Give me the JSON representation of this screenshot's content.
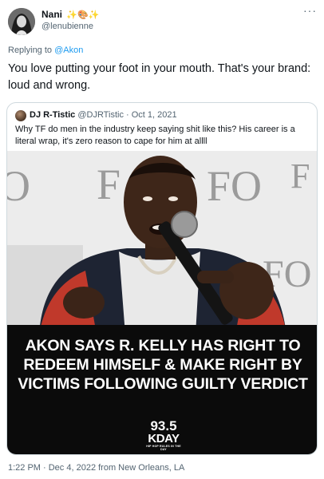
{
  "author": {
    "display_name": "Nani",
    "badge": "✨🎨✨",
    "handle": "@lenubienne"
  },
  "reply": {
    "prefix": "Replying to ",
    "mention": "@Akon"
  },
  "tweet": {
    "text": "You love putting your foot in your mouth. That's your brand: loud and wrong."
  },
  "quoted": {
    "name": "DJ R-Tistic",
    "meta": "@DJRTistic · Oct 1, 2021",
    "text": "Why TF do men in the industry keep saying shit like this? His career is a literal wrap, it's zero reason to cape for him at allll",
    "headline": "AKON SAYS R. KELLY HAS RIGHT TO REDEEM HIMSELF & MAKE RIGHT BY VICTIMS FOLLOWING GUILTY VERDICT",
    "station_freq": "93.5",
    "station_name": "KDAY",
    "station_tag": "HIP HOP RULES IN THE DAY"
  },
  "footer": {
    "timestamp": "1:22 PM · Dec 4, 2022 from New Orleans, LA"
  },
  "icons": {
    "more": "more-icon"
  },
  "colors": {
    "link": "#1d9bf0",
    "secondary_text": "#536471",
    "border": "#cfd9de"
  }
}
